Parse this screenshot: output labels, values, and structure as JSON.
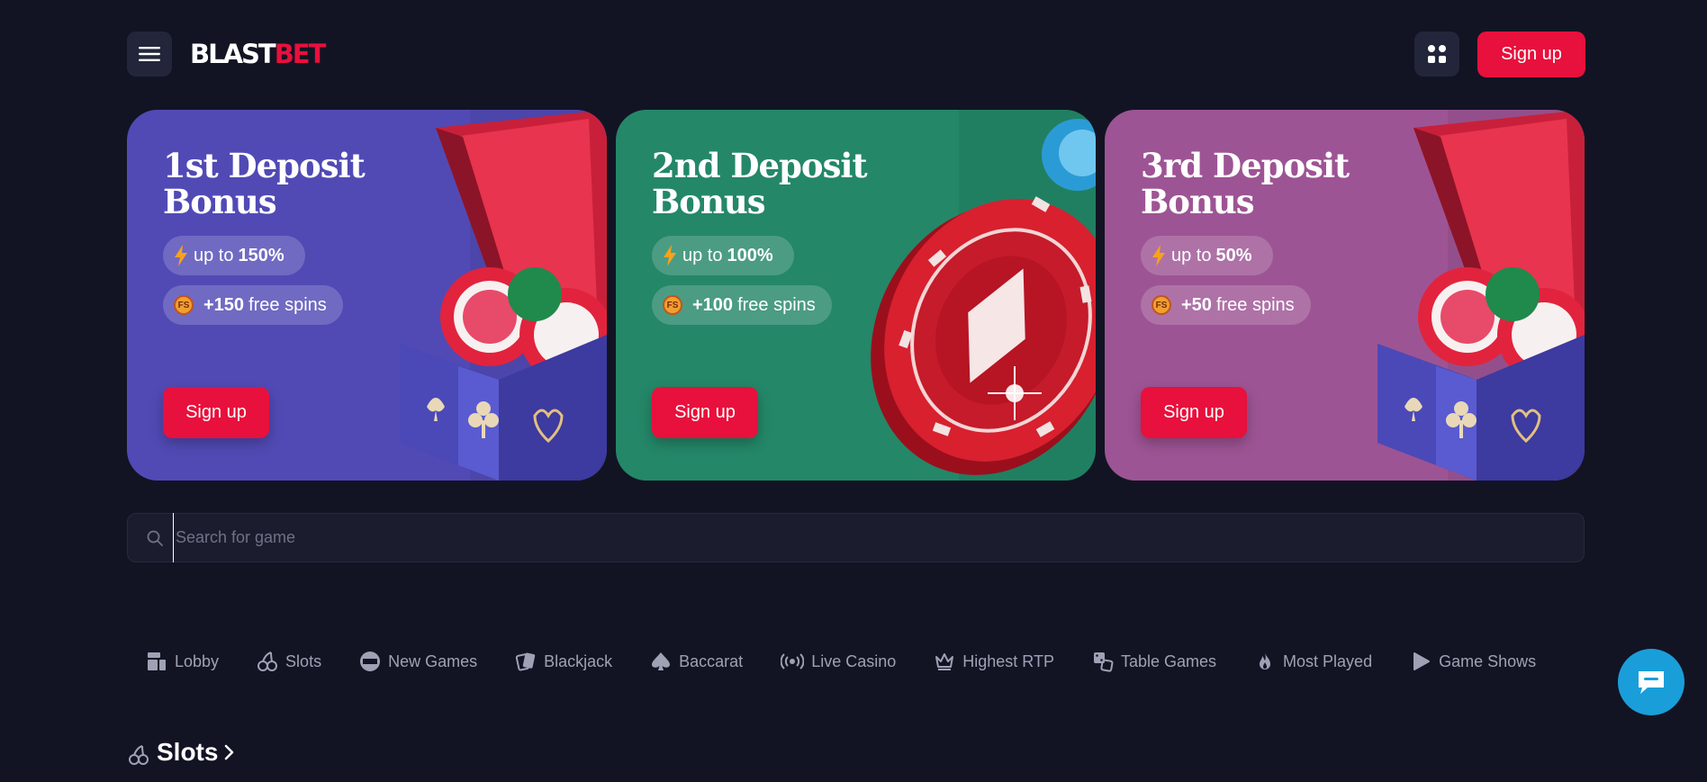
{
  "header": {
    "logo_part1": "BLAST",
    "logo_part2": "BET",
    "signup_label": "Sign up"
  },
  "promos": [
    {
      "title": "1st Deposit Bonus",
      "pill1_prefix": "up to",
      "pill1_value": "150%",
      "pill2_value": "+150",
      "pill2_suffix": "free spins",
      "signup_label": "Sign up"
    },
    {
      "title": "2nd Deposit Bonus",
      "pill1_prefix": "up to",
      "pill1_value": "100%",
      "pill2_value": "+100",
      "pill2_suffix": "free spins",
      "signup_label": "Sign up"
    },
    {
      "title": "3rd Deposit Bonus",
      "pill1_prefix": "up to",
      "pill1_value": "50%",
      "pill2_value": "+50",
      "pill2_suffix": "free spins",
      "signup_label": "Sign up"
    }
  ],
  "fs_badge": "FS",
  "search": {
    "placeholder": "Search for game"
  },
  "categories": [
    {
      "label": "Lobby",
      "icon": "lobby-icon"
    },
    {
      "label": "Slots",
      "icon": "cherries-icon"
    },
    {
      "label": "New Games",
      "icon": "new-badge-icon"
    },
    {
      "label": "Blackjack",
      "icon": "cards-icon"
    },
    {
      "label": "Baccarat",
      "icon": "spade-icon"
    },
    {
      "label": "Live Casino",
      "icon": "broadcast-icon"
    },
    {
      "label": "Highest RTP",
      "icon": "crown-icon"
    },
    {
      "label": "Table Games",
      "icon": "dice-icon"
    },
    {
      "label": "Most Played",
      "icon": "fire-icon"
    },
    {
      "label": "Game Shows",
      "icon": "play-icon"
    }
  ],
  "section": {
    "title": "Slots"
  },
  "colors": {
    "accent": "#e8103c",
    "background": "#121424",
    "card1": "#514ab5",
    "card2": "#248768",
    "card3": "#9d5494",
    "chat": "#1a9ed9"
  }
}
